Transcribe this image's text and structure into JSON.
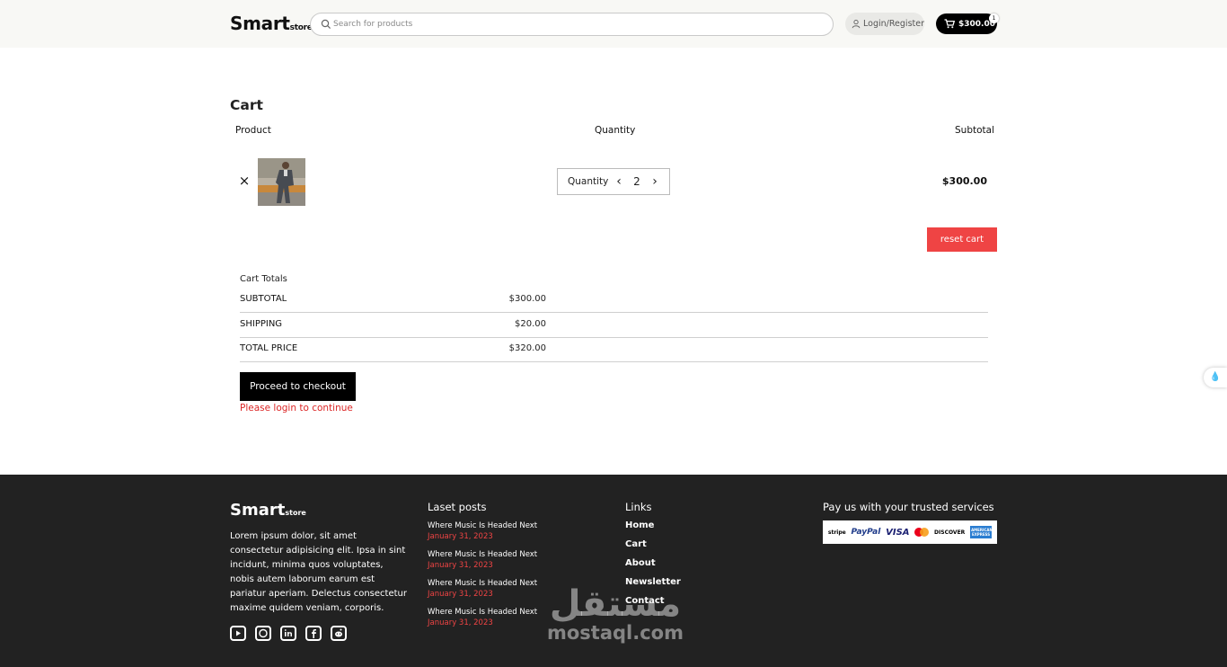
{
  "header": {
    "logo_main": "Smart",
    "logo_sub": "store",
    "search_placeholder": "Search for products",
    "login_label": "Login/Register",
    "cart_total": "$300.00",
    "cart_count": "1"
  },
  "cart": {
    "title": "Cart",
    "columns": {
      "product": "Product",
      "quantity": "Quantity",
      "subtotal": "Subtotal"
    },
    "items": [
      {
        "remove_icon": "×",
        "quantity_label": "Quantity",
        "quantity": "2",
        "subtotal": "$300.00"
      }
    ],
    "reset_label": "reset cart"
  },
  "totals": {
    "title": "Cart Totals",
    "rows": [
      {
        "label": "SUBTOTAL",
        "value": "$300.00"
      },
      {
        "label": "SHIPPING",
        "value": "$20.00"
      },
      {
        "label": "TOTAL PRICE",
        "value": "$320.00"
      }
    ],
    "checkout_label": "Proceed to checkout",
    "login_message": "Please login to continue"
  },
  "footer": {
    "logo_main": "Smart",
    "logo_sub": "store",
    "description": "Lorem ipsum dolor, sit amet consectetur adipisicing elit. Ipsa in sint incidunt, minima quos voluptates, nobis autem laborum earum est pariatur aperiam. Delectus consectetur maxime quidem veniam, corporis.",
    "posts_heading": "Laset posts",
    "posts": [
      {
        "title": "Where Music Is Headed Next",
        "date": "January 31, 2023"
      },
      {
        "title": "Where Music Is Headed Next",
        "date": "January 31, 2023"
      },
      {
        "title": "Where Music Is Headed Next",
        "date": "January 31, 2023"
      },
      {
        "title": "Where Music Is Headed Next",
        "date": "January 31, 2023"
      }
    ],
    "links_heading": "Links",
    "links": [
      "Home",
      "Cart",
      "About",
      "Newsletter",
      "Contact"
    ],
    "pay_heading": "Pay us with your trusted services",
    "payment_methods": [
      "stripe",
      "PayPal",
      "VISA",
      "mastercard",
      "DISCOVER",
      "AMERICAN EXPRESS"
    ],
    "socials": [
      "youtube-icon",
      "github-icon",
      "linkedin-icon",
      "facebook-icon",
      "reddit-icon"
    ],
    "watermark_ar": "مستقل",
    "watermark_en": "mostaql.com"
  },
  "colors": {
    "accent_red": "#ef4444",
    "footer_bg": "#222222",
    "header_bg": "#f8f8f5"
  }
}
